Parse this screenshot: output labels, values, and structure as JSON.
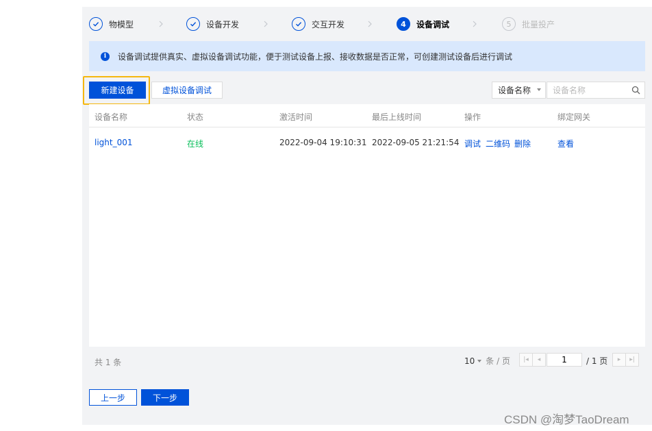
{
  "colors": {
    "primary": "#0052d9",
    "online": "#0abf5b",
    "highlight": "#f5b70f",
    "banner_bg": "#d9e8fd"
  },
  "steps": [
    {
      "label": "物模型",
      "state": "done"
    },
    {
      "label": "设备开发",
      "state": "done"
    },
    {
      "label": "交互开发",
      "state": "done"
    },
    {
      "number": "4",
      "label": "设备调试",
      "state": "active"
    },
    {
      "number": "5",
      "label": "批量投产",
      "state": "todo"
    }
  ],
  "banner": {
    "icon": "info-icon",
    "text": "设备调试提供真实、虚拟设备调试功能，便于测试设备上报、接收数据是否正常，可创建测试设备后进行调试"
  },
  "toolbar": {
    "new_device": "新建设备",
    "virtual_debug": "虚拟设备调试",
    "filter_select": "设备名称",
    "search_placeholder": "设备名称"
  },
  "table": {
    "headers": [
      "设备名称",
      "状态",
      "激活时间",
      "最后上线时间",
      "操作",
      "绑定网关"
    ],
    "rows": [
      {
        "name": "light_001",
        "status": "在线",
        "activated": "2022-09-04 19:10:31",
        "last_online": "2022-09-05 21:21:54",
        "actions": [
          "调试",
          "二维码",
          "删除"
        ],
        "gateway": "查看"
      }
    ]
  },
  "pagination": {
    "total_text": "共 1 条",
    "page_size": "10",
    "page_size_unit": "条 / 页",
    "current_page": "1",
    "total_pages": "/ 1 页"
  },
  "footer": {
    "prev": "上一步",
    "next": "下一步"
  },
  "watermark": "CSDN @淘梦TaoDream"
}
